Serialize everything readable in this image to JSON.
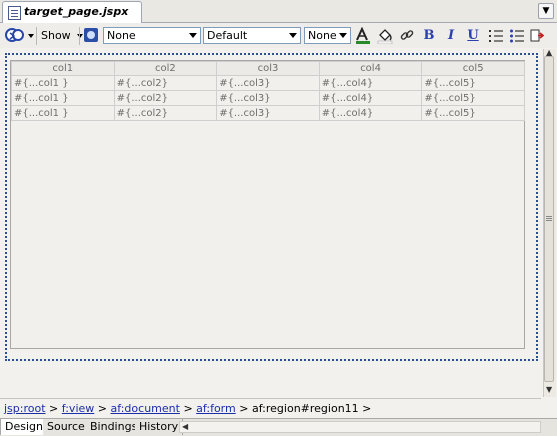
{
  "editor": {
    "file_tab": "target_page.jspx",
    "file_icon": "jspx-file-icon"
  },
  "toolbar": {
    "show_label": "Show",
    "combo1": "None",
    "combo2": "Default",
    "combo3": "None",
    "bold_label": "B",
    "italic_label": "I",
    "underline_label": "U"
  },
  "table": {
    "headers": [
      "col1",
      "col2",
      "col3",
      "col4",
      "col5"
    ],
    "rows": [
      [
        "#{...col1 }",
        "#{...col2}",
        "#{...col3}",
        "#{...col4}",
        "#{...col5}"
      ],
      [
        "#{...col1 }",
        "#{...col2}",
        "#{...col3}",
        "#{...col4}",
        "#{...col5}"
      ],
      [
        "#{...col1 }",
        "#{...col2}",
        "#{...col3}",
        "#{...col4}",
        "#{...col5}"
      ]
    ]
  },
  "breadcrumb": {
    "items": [
      {
        "label": "jsp:root",
        "link": true
      },
      {
        "label": "f:view",
        "link": true
      },
      {
        "label": "af:document",
        "link": true
      },
      {
        "label": "af:form",
        "link": true
      },
      {
        "label": "af:region#region11",
        "link": false
      }
    ],
    "separator": ">"
  },
  "bottom_tabs": [
    {
      "label": "Design",
      "active": true
    },
    {
      "label": "Source",
      "active": false
    },
    {
      "label": "Bindings",
      "active": false
    },
    {
      "label": "History",
      "active": false
    }
  ],
  "colors": {
    "link": "#1b2ea8",
    "accent": "#2a3fb0",
    "dotted_border": "#2d4f8e"
  }
}
